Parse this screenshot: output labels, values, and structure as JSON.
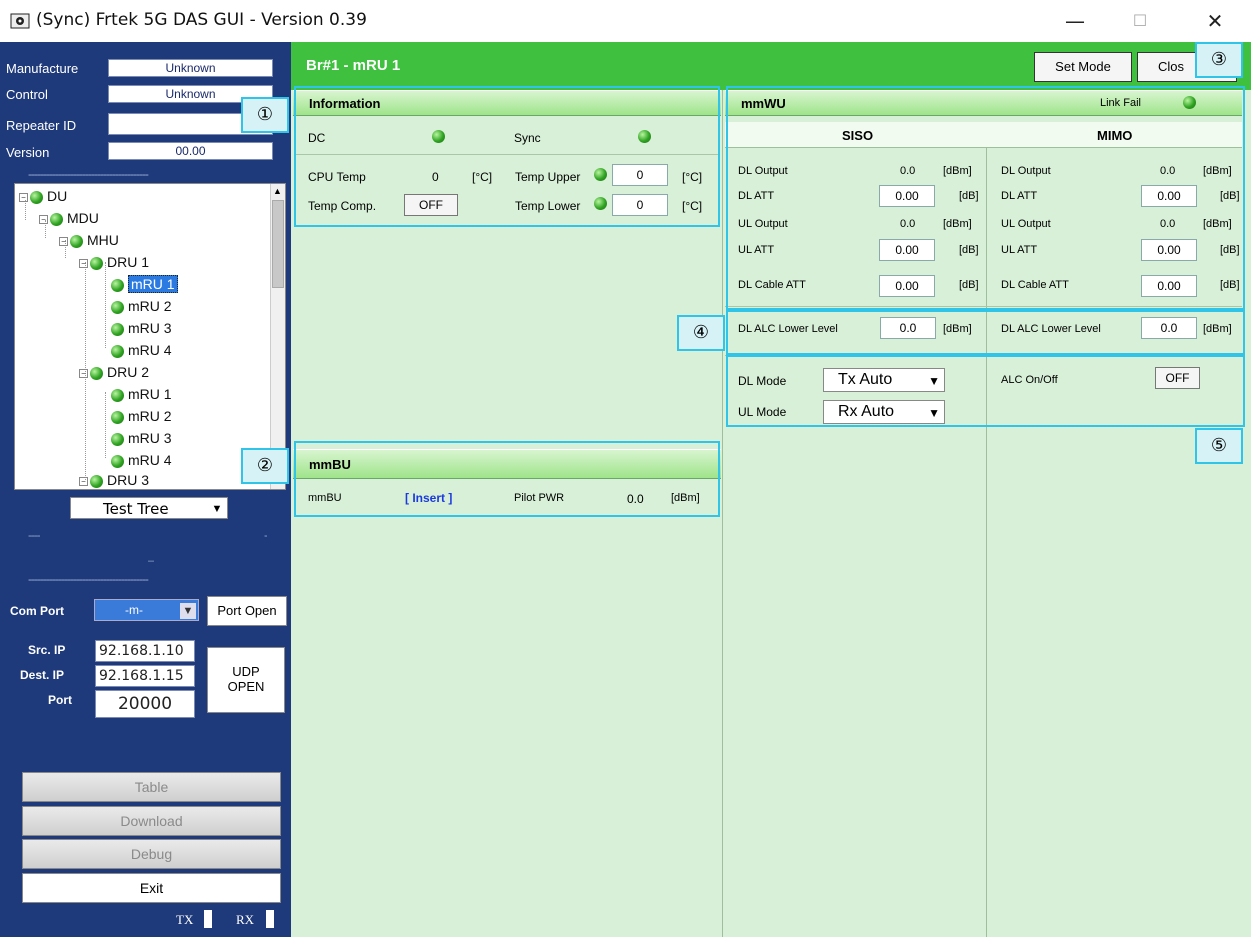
{
  "window": {
    "title": "(Sync) Frtek 5G DAS GUI - Version 0.39",
    "minimize": "—",
    "maximize": "☐",
    "close": "✕"
  },
  "left": {
    "manufacture_label": "Manufacture",
    "manufacture_value": "Unknown",
    "control_label": "Control",
    "control_value": "Unknown",
    "repeater_label": "Repeater ID",
    "repeater_value": "",
    "version_label": "Version",
    "version_value": "00.00",
    "dash": "----------------------------------------",
    "tree": [
      {
        "label": "DU"
      },
      {
        "label": "MDU"
      },
      {
        "label": "MHU"
      },
      {
        "label": "DRU 1"
      },
      {
        "label": "mRU 1"
      },
      {
        "label": "mRU 2"
      },
      {
        "label": "mRU 3"
      },
      {
        "label": "mRU 4"
      },
      {
        "label": "DRU 2"
      },
      {
        "label": "mRU 1"
      },
      {
        "label": "mRU 2"
      },
      {
        "label": "mRU 3"
      },
      {
        "label": "mRU 4"
      },
      {
        "label": "DRU 3"
      }
    ],
    "tree_select": "Test Tree",
    "small_dash": "----",
    "small_dash2": "-",
    "underscore": "_",
    "com_port_label": "Com Port",
    "com_port_value": "-m-",
    "port_open": "Port Open",
    "src_ip_label": "Src. IP",
    "src_ip_value": "92.168.1.10",
    "dest_ip_label": "Dest. IP",
    "dest_ip_value": "92.168.1.15",
    "port_label": "Port",
    "port_value": "20000",
    "udp_open_1": "UDP",
    "udp_open_2": "OPEN",
    "table": "Table",
    "download": "Download",
    "debug": "Debug",
    "exit": "Exit",
    "tx": "TX",
    "rx": "RX"
  },
  "header": {
    "title": "Br#1 - mRU 1",
    "set_mode": "Set Mode",
    "close": "Clos"
  },
  "info": {
    "title": "Information",
    "dc": "DC",
    "sync": "Sync",
    "cpu_temp": "CPU Temp",
    "cpu_temp_value": "0",
    "unit_c": "[°C]",
    "temp_upper": "Temp Upper",
    "temp_upper_value": "0",
    "temp_comp": "Temp Comp.",
    "temp_comp_value": "OFF",
    "temp_lower": "Temp Lower",
    "temp_lower_value": "0"
  },
  "mmbu": {
    "title": "mmBU",
    "label": "mmBU",
    "insert": "[ Insert ]",
    "pilot": "Pilot PWR",
    "pilot_value": "0.0",
    "unit": "[dBm]"
  },
  "mmwu": {
    "title": "mmWU",
    "link_fail": "Link Fail",
    "siso": "SISO",
    "mimo": "MIMO",
    "dl_output": "DL Output",
    "dl_att": "DL ATT",
    "ul_output": "UL Output",
    "ul_att": "UL ATT",
    "dl_cable_att": "DL Cable ATT",
    "dl_alc": "DL ALC Lower Level",
    "out_value": "0.0",
    "att_value": "0.00",
    "alc_value": "0.0",
    "unit_dbm": "[dBm]",
    "unit_db": "[dB]",
    "dl_mode": "DL Mode",
    "dl_mode_value": "Tx Auto",
    "ul_mode": "UL Mode",
    "ul_mode_value": "Rx Auto",
    "alc_onoff": "ALC On/Off",
    "alc_onoff_value": "OFF"
  },
  "callouts": [
    "①",
    "②",
    "③",
    "④",
    "⑤"
  ],
  "colors": {
    "header_green": "#3fc03f",
    "panel_bg": "#d8f0d8",
    "left_bg": "#1f3a7a",
    "callout": "#2fc4e8",
    "led_green": "#2fa321"
  }
}
